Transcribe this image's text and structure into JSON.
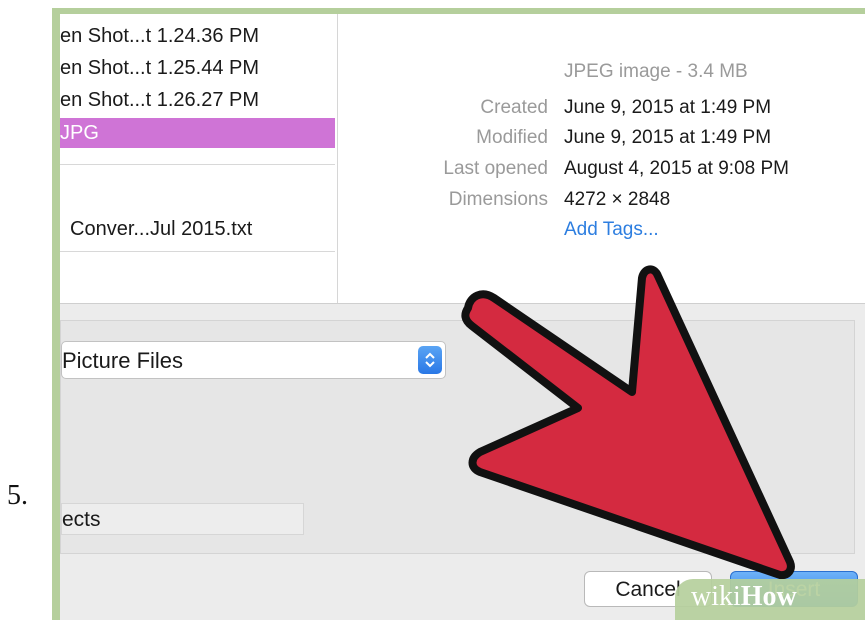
{
  "step_number": "5.",
  "file_list": {
    "items": [
      {
        "label": "en Shot...t 1.24.36 PM"
      },
      {
        "label": "en Shot...t 1.25.44 PM"
      },
      {
        "label": "en Shot...t 1.26.27 PM"
      },
      {
        "label": "JPG",
        "selected": true
      },
      {
        "label": "Conver...Jul 2015.txt"
      }
    ],
    "selected_color": "#cf74d6"
  },
  "info": {
    "type_size": "JPEG image - 3.4 MB",
    "rows": [
      {
        "label": "Created",
        "value": "June 9, 2015 at 1:49 PM"
      },
      {
        "label": "Modified",
        "value": "June 9, 2015 at 1:49 PM"
      },
      {
        "label": "Last opened",
        "value": "August 4, 2015 at 9:08 PM"
      },
      {
        "label": "Dimensions",
        "value": "4272 × 2848"
      }
    ],
    "add_tags": "Add Tags..."
  },
  "file_type_select": {
    "value": "Picture Files"
  },
  "objects_field": {
    "label": "ects"
  },
  "buttons": {
    "cancel": "Cancel",
    "insert": "Insert"
  },
  "watermark": {
    "wiki": "wiki",
    "how": "How"
  },
  "colors": {
    "frame": "#b5cf9c",
    "arrow": "#d42a40",
    "accent": "#2b7de8",
    "link": "#2d7ee0"
  },
  "icons": {
    "arrow": "red-pointer-arrow-icon",
    "stepper": "up-down-chevron-icon"
  }
}
